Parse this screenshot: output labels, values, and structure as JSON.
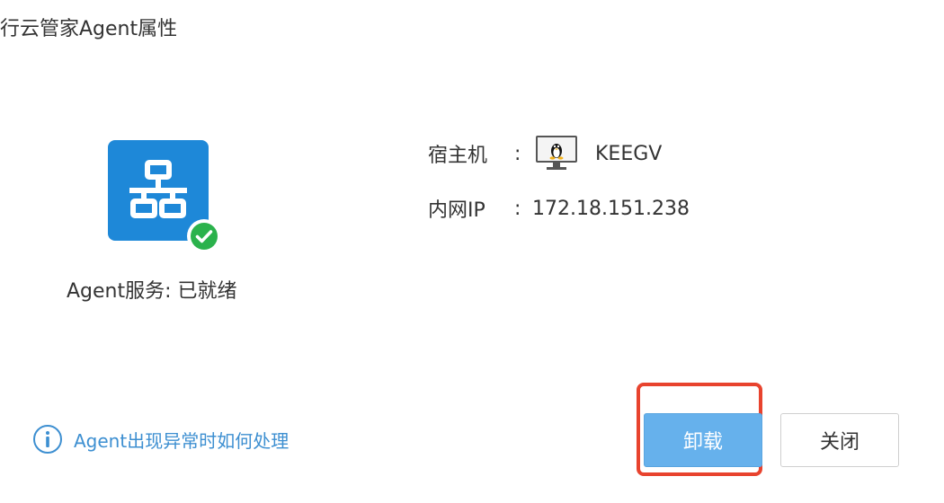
{
  "dialog": {
    "title": "行云管家Agent属性"
  },
  "agent": {
    "icon": "network-topology-icon",
    "badge_icon": "check-circle-icon",
    "status_text": "Agent服务: 已就绪",
    "colors": {
      "icon_bg": "#1e88d8",
      "badge": "#2bb24c"
    }
  },
  "host": {
    "label": "宿主机",
    "colon": ":",
    "os_icon": "linux-monitor-icon",
    "name": "KEEGV"
  },
  "network": {
    "label": "内网IP",
    "colon": ":",
    "value": "172.18.151.238"
  },
  "help": {
    "icon": "info-icon",
    "link_text": "Agent出现异常时如何处理",
    "color": "#3d8fd1"
  },
  "buttons": {
    "uninstall_label": "卸载",
    "close_label": "关闭",
    "primary_color": "#66b1ec",
    "highlight_color": "#e8432e"
  }
}
